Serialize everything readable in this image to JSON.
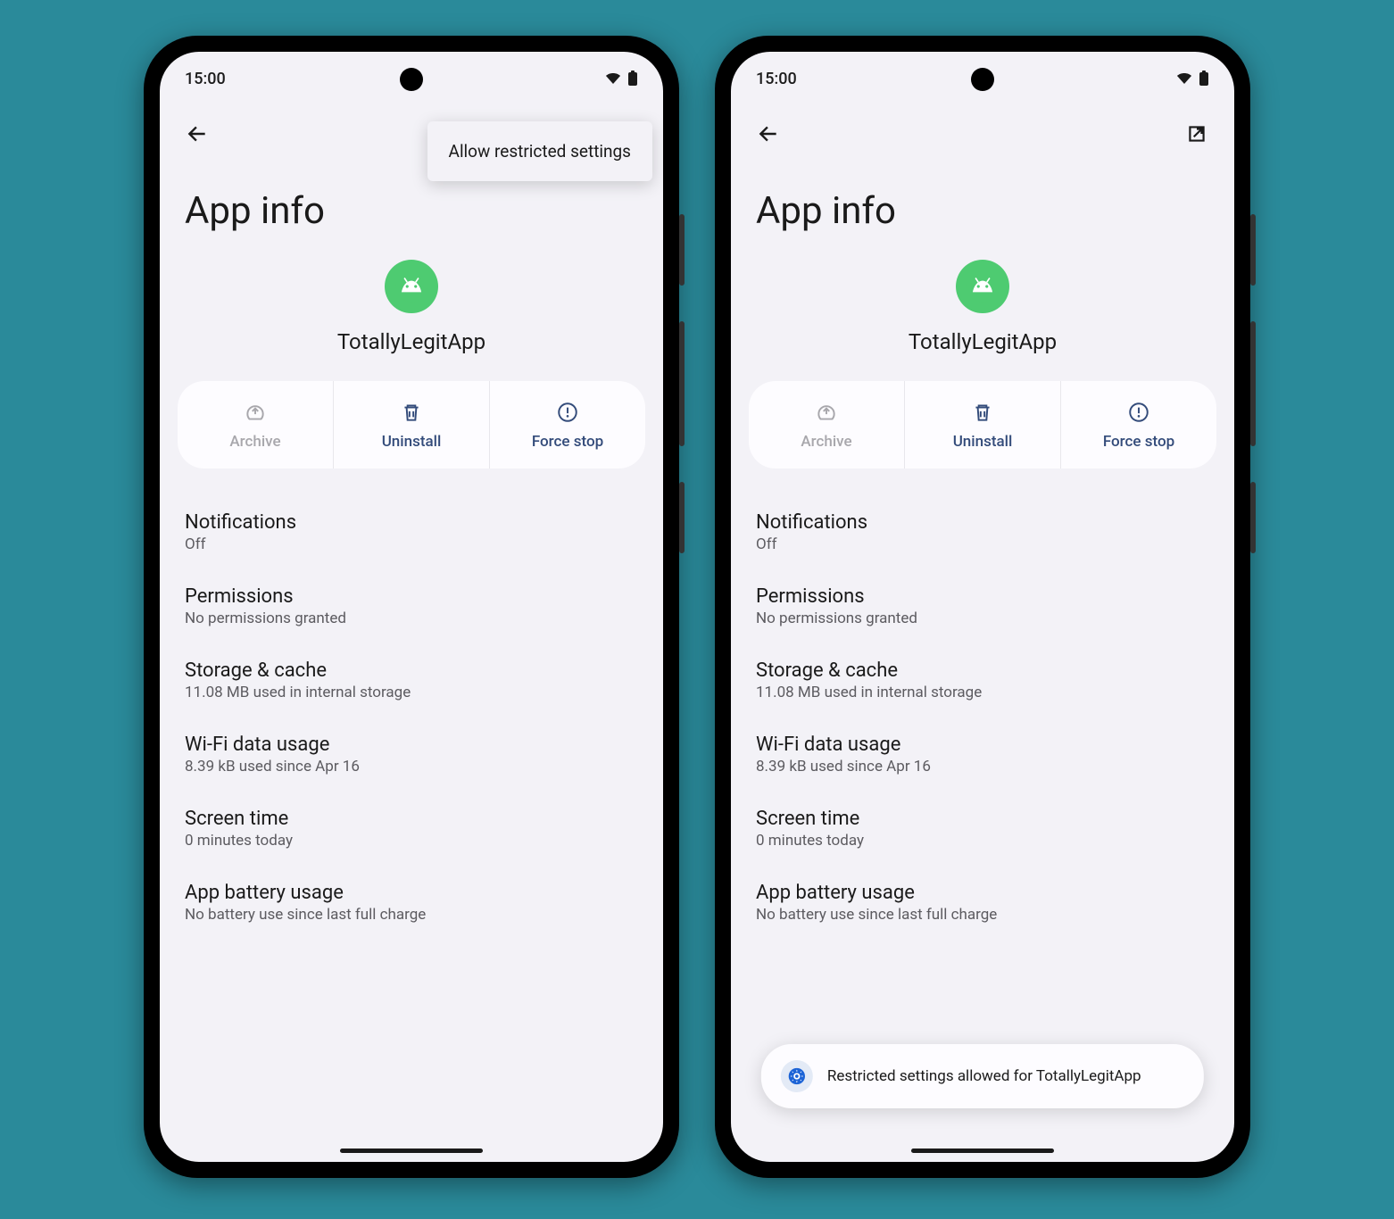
{
  "status": {
    "time": "15:00"
  },
  "page": {
    "title": "App info"
  },
  "app": {
    "name": "TotallyLegitApp"
  },
  "actions": {
    "archive": "Archive",
    "uninstall": "Uninstall",
    "forcestop": "Force stop"
  },
  "settings": [
    {
      "title": "Notifications",
      "sub": "Off"
    },
    {
      "title": "Permissions",
      "sub": "No permissions granted"
    },
    {
      "title": "Storage & cache",
      "sub": "11.08 MB used in internal storage"
    },
    {
      "title": "Wi-Fi data usage",
      "sub": "8.39 kB used since Apr 16"
    },
    {
      "title": "Screen time",
      "sub": "0 minutes today"
    },
    {
      "title": "App battery usage",
      "sub": "No battery use since last full charge"
    }
  ],
  "menu": {
    "item": "Allow restricted settings"
  },
  "toast": {
    "text": "Restricted settings allowed for TotallyLegitApp"
  }
}
